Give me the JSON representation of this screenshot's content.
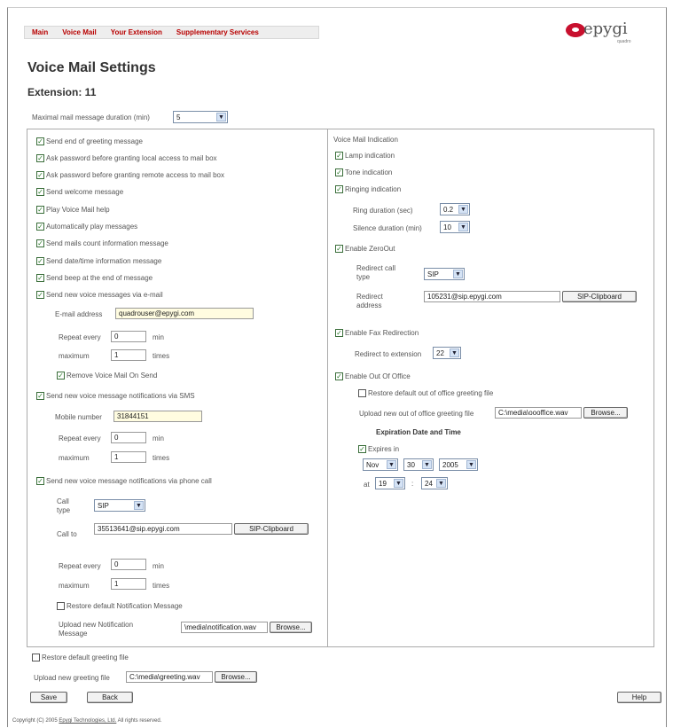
{
  "nav": [
    "Main",
    "Voice Mail",
    "Your Extension",
    "Supplementary Services"
  ],
  "logo": {
    "name": "epygi",
    "sub": "quadro"
  },
  "title": "Voice Mail Settings",
  "extension": "Extension: 11",
  "max_duration": {
    "label": "Maximal mail message duration (min)",
    "value": "5"
  },
  "left": {
    "checks": [
      {
        "label": "Send end of greeting message",
        "checked": true
      },
      {
        "label": "Ask password before granting local access to mail box",
        "checked": true
      },
      {
        "label": "Ask password before granting remote access to mail box",
        "checked": true
      },
      {
        "label": "Send welcome message",
        "checked": true
      },
      {
        "label": "Play Voice Mail help",
        "checked": true
      },
      {
        "label": "Automatically play messages",
        "checked": true
      },
      {
        "label": "Send mails count information message",
        "checked": true
      },
      {
        "label": "Send date/time information message",
        "checked": true
      },
      {
        "label": "Send beep at the end of message",
        "checked": true
      },
      {
        "label": "Send new voice messages via e-mail",
        "checked": true
      }
    ],
    "email": {
      "address_label": "E-mail address",
      "address": "quadrouser@epygi.com",
      "repeat_label": "Repeat every",
      "repeat": "0",
      "repeat_unit": "min",
      "max_label": "maximum",
      "max": "1",
      "max_unit": "times",
      "remove_label": "Remove Voice Mail On Send"
    },
    "sms": {
      "check_label": "Send new voice message notifications via SMS",
      "mobile_label": "Mobile number",
      "mobile": "31844151",
      "repeat_label": "Repeat every",
      "repeat": "0",
      "repeat_unit": "min",
      "max_label": "maximum",
      "max": "1",
      "max_unit": "times"
    },
    "phone": {
      "check_label": "Send new voice message notifications via phone call",
      "call_type_label": "Call type",
      "call_type": "SIP",
      "call_to_label": "Call to",
      "call_to": "35513641@sip.epygi.com",
      "clipboard": "SIP-Clipboard",
      "repeat_label": "Repeat every",
      "repeat": "0",
      "repeat_unit": "min",
      "max_label": "maximum",
      "max": "1",
      "max_unit": "times",
      "restore_label": "Restore default Notification Message",
      "upload_label": "Upload new Notification Message",
      "upload_value": "\\media\\notification.wav",
      "browse": "Browse..."
    }
  },
  "right": {
    "heading": "Voice Mail Indication",
    "lamp": "Lamp indication",
    "tone": "Tone indication",
    "ringing": "Ringing indication",
    "ring_duration_label": "Ring duration (sec)",
    "ring_duration": "0.2",
    "silence_label": "Silence duration (min)",
    "silence": "10",
    "zeroout": "Enable ZeroOut",
    "redirect_type_label": "Redirect call type",
    "redirect_type": "SIP",
    "redirect_addr_label": "Redirect address",
    "redirect_addr": "105231@sip.epygi.com",
    "clipboard": "SIP-Clipboard",
    "fax": "Enable Fax Redirection",
    "fax_ext_label": "Redirect to extension",
    "fax_ext": "22",
    "ooo": "Enable Out Of Office",
    "ooo_restore": "Restore default out of office greeting file",
    "ooo_upload_label": "Upload new out of office greeting file",
    "ooo_upload_value": "C:\\media\\oooffice.wav",
    "browse": "Browse...",
    "exp_heading": "Expiration Date and Time",
    "expires_label": "Expires in",
    "month": "Nov",
    "day": "30",
    "year": "2005",
    "at_label": "at",
    "hour": "19",
    "colon": ":",
    "minute": "24"
  },
  "bottom": {
    "restore_label": "Restore default greeting file",
    "upload_label": "Upload new greeting file",
    "upload_value": "C:\\media\\greeting.wav",
    "browse": "Browse...",
    "save": "Save",
    "back": "Back",
    "help": "Help"
  },
  "footer": {
    "prefix": "Copyright (C) 2005",
    "link": "Epygi Technologies, Ltd.",
    "suffix": "All rights reserved."
  }
}
